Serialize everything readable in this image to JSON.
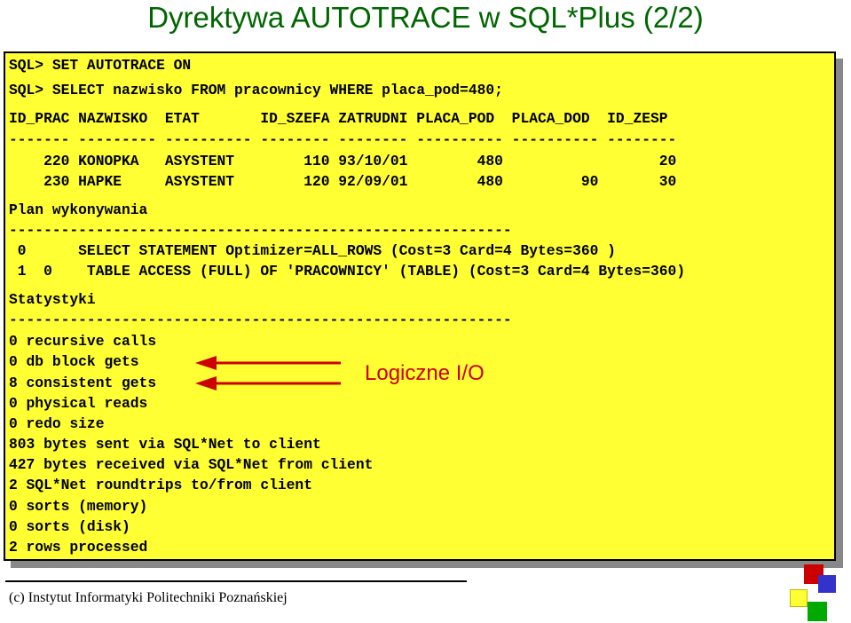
{
  "title": "Dyrektywa AUTOTRACE w SQL*Plus (2/2)",
  "colors": {
    "title": "#006600",
    "panel": "#ffff33",
    "annotation": "#cc0000"
  },
  "sql_lines": [
    "SQL> SET AUTOTRACE ON",
    "SQL> SELECT nazwisko FROM pracownicy WHERE placa_pod=480;",
    "ID_PRAC NAZWISKO  ETAT       ID_SZEFA ZATRUDNI PLACA_POD  PLACA_DOD  ID_ZESP",
    "------- --------- ---------- -------- -------- ---------- ---------- --------",
    "    220 KONOPKA   ASYSTENT        110 93/10/01        480                  20",
    "    230 HAPKE     ASYSTENT        120 92/09/01        480         90       30",
    "Plan wykonywania",
    "----------------------------------------------------------",
    " 0      SELECT STATEMENT Optimizer=ALL_ROWS (Cost=3 Card=4 Bytes=360 )",
    " 1  0    TABLE ACCESS (FULL) OF 'PRACOWNICY' (TABLE) (Cost=3 Card=4 Bytes=360)",
    "Statystyki",
    "----------------------------------------------------------",
    "0 recursive calls",
    "0 db block gets",
    "8 consistent gets",
    "0 physical reads",
    "0 redo size",
    "803 bytes sent via SQL*Net to client",
    "427 bytes received via SQL*Net from client",
    "2 SQL*Net roundtrips to/from client",
    "0 sorts (memory)",
    "0 sorts (disk)",
    "2 rows processed"
  ],
  "annotation": "Logiczne I/O",
  "footer": "(c) Instytut Informatyki Politechniki Poznańskiej",
  "icons": [
    "arrow-left-icon",
    "arrow-left-icon",
    "decorative-squares-icon"
  ]
}
